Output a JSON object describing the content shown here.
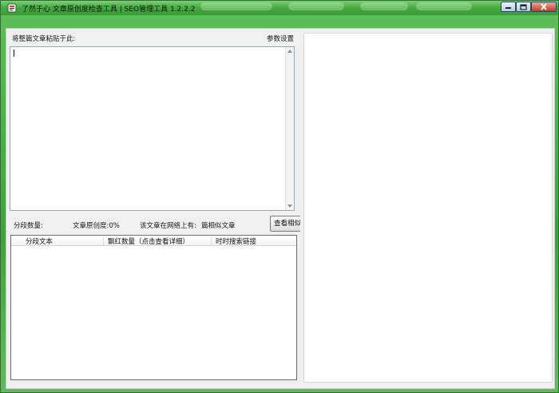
{
  "window": {
    "title": "了然于心 文章原创度检查工具 | SEO管理工具  1.2.2.2"
  },
  "left_panel": {
    "paste_label": "将整篇文章粘贴于此:",
    "settings_link": "参数设置",
    "article_text": "",
    "segment_count_label": "分段数量:",
    "originality_label": "文章原创度:0%",
    "similar_label": "该文章在网络上有:",
    "similar_count_label": "篇相似文章",
    "view_similar_button": "查看相似"
  },
  "results_table": {
    "columns": [
      "分段文本",
      "飘红数量（点击查看详细）",
      "时时搜索链接"
    ],
    "rows": []
  },
  "colors": {
    "titlebar_green": "#45a842",
    "close_red": "#c23a25"
  }
}
